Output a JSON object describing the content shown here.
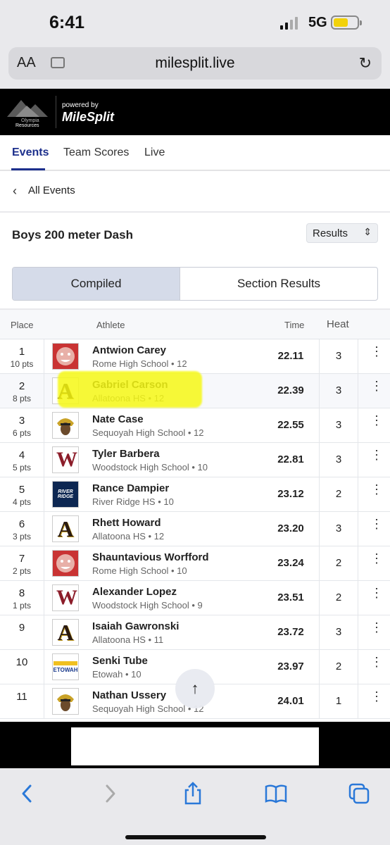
{
  "status_bar": {
    "time": "6:41",
    "network": "5G"
  },
  "browser": {
    "aa_label": "AA",
    "url": "milesplit.live"
  },
  "header": {
    "powered_by": "powered by",
    "brand": "MileSplit",
    "logo_text_top": "Olympia",
    "logo_text_bottom": "Resources"
  },
  "tabs": [
    {
      "label": "Events"
    },
    {
      "label": "Team Scores"
    },
    {
      "label": "Live"
    }
  ],
  "back": {
    "label": "All Events"
  },
  "event": {
    "title": "Boys 200 meter Dash",
    "results_select": "Results"
  },
  "segments": {
    "compiled": "Compiled",
    "section": "Section Results"
  },
  "table": {
    "headers": {
      "place": "Place",
      "athlete": "Athlete",
      "time": "Time",
      "heat": "Heat"
    },
    "rows": [
      {
        "place": "1",
        "pts": "10 pts",
        "name": "Antwion Carey",
        "school": "Rome High School • 12",
        "time": "22.11",
        "heat": "3",
        "team": "rome"
      },
      {
        "place": "2",
        "pts": "8 pts",
        "name": "Gabriel Carson",
        "school": "Allatoona HS • 12",
        "time": "22.39",
        "heat": "3",
        "team": "allatoona"
      },
      {
        "place": "3",
        "pts": "6 pts",
        "name": "Nate Case",
        "school": "Sequoyah High School • 12",
        "time": "22.55",
        "heat": "3",
        "team": "sequoyah"
      },
      {
        "place": "4",
        "pts": "5 pts",
        "name": "Tyler Barbera",
        "school": "Woodstock High School • 10",
        "time": "22.81",
        "heat": "3",
        "team": "woodstock"
      },
      {
        "place": "5",
        "pts": "4 pts",
        "name": "Rance Dampier",
        "school": "River Ridge HS • 10",
        "time": "23.12",
        "heat": "2",
        "team": "riverridge"
      },
      {
        "place": "6",
        "pts": "3 pts",
        "name": "Rhett Howard",
        "school": "Allatoona HS • 12",
        "time": "23.20",
        "heat": "3",
        "team": "allatoona"
      },
      {
        "place": "7",
        "pts": "2 pts",
        "name": "Shauntavious Worfford",
        "school": "Rome High School • 10",
        "time": "23.24",
        "heat": "2",
        "team": "rome"
      },
      {
        "place": "8",
        "pts": "1 pts",
        "name": "Alexander Lopez",
        "school": "Woodstock High School • 9",
        "time": "23.51",
        "heat": "2",
        "team": "woodstock"
      },
      {
        "place": "9",
        "pts": "",
        "name": "Isaiah Gawronski",
        "school": "Allatoona HS • 11",
        "time": "23.72",
        "heat": "3",
        "team": "allatoona"
      },
      {
        "place": "10",
        "pts": "",
        "name": "Senki Tube",
        "school": "Etowah • 10",
        "time": "23.97",
        "heat": "2",
        "team": "etowah"
      },
      {
        "place": "11",
        "pts": "",
        "name": "Nathan Ussery",
        "school": "Sequoyah High School • 12",
        "time": "24.01",
        "heat": "1",
        "team": "sequoyah"
      }
    ]
  },
  "team_logo_text": {
    "allatoona": "A",
    "woodstock": "W",
    "riverridge": "RIVER RIDGE",
    "etowah": "ETOWAH"
  },
  "colors": {
    "accent": "#1c2f8c",
    "highlight": "#f6f814",
    "rome_red": "#c93333",
    "allatoona_gold": "#c9a227"
  }
}
